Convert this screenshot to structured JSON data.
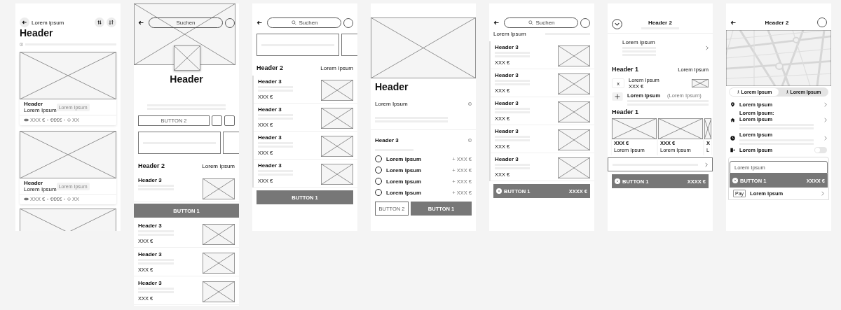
{
  "screens": [
    {
      "kind": "list",
      "top_label": "Lorem ipsum",
      "title": "Header",
      "cards": [
        {
          "kind": "full",
          "title": "Header",
          "subtitle": "Lorem Ipsum",
          "tag": "Lorem Ipsum",
          "price": "XXX €",
          "price_range": "€€€€",
          "count": "XX"
        },
        {
          "kind": "full",
          "title": "Header",
          "subtitle": "Lorem Ipsum",
          "tag": "Lorem Ipsum",
          "price": "XXX €",
          "price_range": "€€€€",
          "count": "XX"
        },
        {
          "kind": "picture"
        }
      ]
    },
    {
      "kind": "detail",
      "search": {
        "placeholder": "Suchen",
        "icon": false
      },
      "title": "Header",
      "secondary_button": "BUTTON 2",
      "section": {
        "title": "Header 2",
        "link": "Lorem Ipsum"
      },
      "items": [
        {
          "title": "Header 3"
        },
        {
          "title": "Header 3",
          "price": "XXX €"
        },
        {
          "title": "Header 3",
          "price": "XXX €"
        },
        {
          "title": "Header 3",
          "price": "XXX €"
        }
      ],
      "primary_button": "BUTTON 1"
    },
    {
      "kind": "search-list",
      "search": {
        "placeholder": "Suchen",
        "icon": true
      },
      "section": {
        "title": "Header 2",
        "link": "Lorem Ipsum"
      },
      "items": [
        {
          "title": "Header 3",
          "price": "XXX €"
        },
        {
          "title": "Header 3",
          "price": "XXX €"
        },
        {
          "title": "Header 3",
          "price": "XXX €"
        },
        {
          "title": "Header 3",
          "price": "XXX €"
        }
      ],
      "primary_button": "BUTTON 1"
    },
    {
      "kind": "options",
      "title": "Header",
      "intro": "Lorem Ipsum",
      "group_title": "Header 3",
      "options": [
        {
          "label": "Lorem Ipsum",
          "price": "+ XXX €",
          "selected": false
        },
        {
          "label": "Lorem Ipsum",
          "price": "+ XXX €",
          "selected": false
        },
        {
          "label": "Lorem Ipsum",
          "price": "+ XXX €",
          "selected": false
        },
        {
          "label": "Lorem Ipsum",
          "price": "+ XXX €",
          "selected": false
        }
      ],
      "secondary_button": "BUTTON 2",
      "primary_button": "BUTTON 1"
    },
    {
      "kind": "results",
      "search": {
        "placeholder": "Suchen",
        "icon": true
      },
      "filter_label": "Lorem Ipsum",
      "items": [
        {
          "title": "Header 3",
          "price": "XXX €"
        },
        {
          "title": "Header 3",
          "price": "XXX €"
        },
        {
          "title": "Header 3",
          "price": "XXX €"
        },
        {
          "title": "Header 3",
          "price": "XXX €"
        },
        {
          "title": "Header 3",
          "price": "XXX €"
        }
      ],
      "checkout": {
        "label": "BUTTON 1",
        "total": "XXXX €"
      }
    },
    {
      "kind": "cart",
      "title": "Header 2",
      "summary_label": "Lorem Ipsum",
      "section": {
        "title": "Header 1",
        "link": "Lorem Ipsum"
      },
      "cart_item": {
        "quantity": "x",
        "name": "Lorem Ipsum",
        "price": "XXX €"
      },
      "add_row": {
        "label": "Lorem Ipsum",
        "note": "(Lorem Ipsum)"
      },
      "products_title": "Header 1",
      "products": [
        {
          "price": "XXX €",
          "name": "Lorem Ipsum"
        },
        {
          "price": "XXX €",
          "name": "Lorem Ipsum"
        },
        {
          "price": "X",
          "name": "L"
        }
      ],
      "checkout": {
        "label": "BUTTON 1",
        "total": "XXXX €"
      }
    },
    {
      "kind": "map",
      "title": "Header 2",
      "modes": [
        {
          "label": "Lorem Ipsum",
          "selected": true
        },
        {
          "label": "Lorem Ipsum",
          "selected": false
        }
      ],
      "rows": [
        {
          "kind": "link",
          "label": "Lorem Ipsum"
        },
        {
          "kind": "link",
          "label": "Lorem Ipsum:",
          "sublabel": "Lorem Ipsum"
        },
        {
          "kind": "link",
          "label": "Lorem Ipsum"
        },
        {
          "kind": "toggle",
          "label": "Lorem Ipsum",
          "on": false
        }
      ],
      "note_field": {
        "placeholder": "Lorem Ipsum"
      },
      "checkout": {
        "label": "BUTTON 1",
        "total": "XXXX €"
      },
      "payment": {
        "badge": "Pay",
        "label": "Lorem Ipsum"
      }
    }
  ]
}
